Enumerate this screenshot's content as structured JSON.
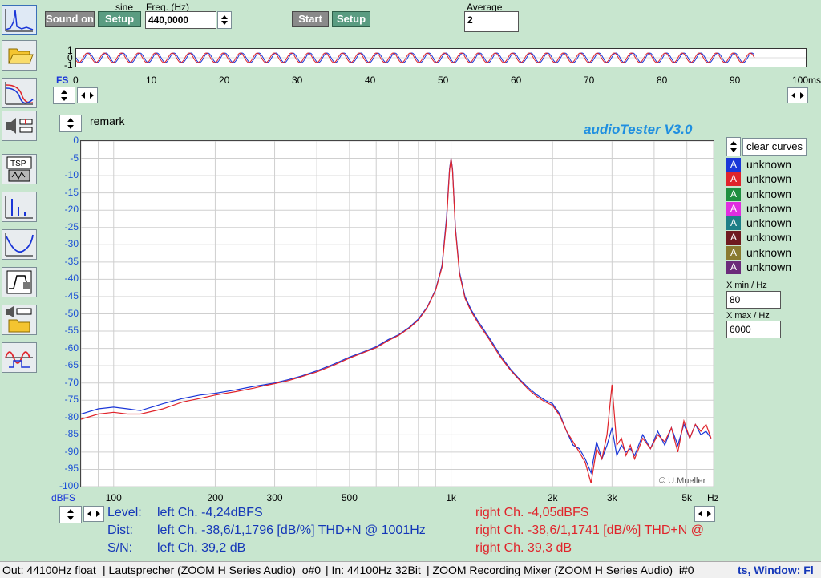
{
  "top": {
    "sound_button": "Sound on",
    "signal_type": "sine",
    "setup_left": "Setup",
    "freq_label": "Freq. (Hz)",
    "freq_value": "440,0000",
    "start_button": "Start",
    "setup_right": "Setup",
    "average_label": "Average",
    "average_value": "2"
  },
  "scope": {
    "y_ticks": [
      "1",
      "0",
      "-1"
    ],
    "fs_label": "FS",
    "x_ticks": [
      "0",
      "10",
      "20",
      "30",
      "40",
      "50",
      "60",
      "70",
      "80",
      "90"
    ],
    "x_unit": "100ms"
  },
  "remark": "remark",
  "app_title": "audioTester  V3.0",
  "copyright": "© U.Mueller",
  "legend": {
    "clear_button": "clear curves",
    "items": [
      {
        "label": "unknown",
        "letter": "A",
        "color": "#1a36d8"
      },
      {
        "label": "unknown",
        "letter": "A",
        "color": "#e0242b"
      },
      {
        "label": "unknown",
        "letter": "A",
        "color": "#1f8f3f"
      },
      {
        "label": "unknown",
        "letter": "A",
        "color": "#e02ee0"
      },
      {
        "label": "unknown",
        "letter": "A",
        "color": "#1d7f86"
      },
      {
        "label": "unknown",
        "letter": "A",
        "color": "#6f1a1f"
      },
      {
        "label": "unknown",
        "letter": "A",
        "color": "#8a7a30"
      },
      {
        "label": "unknown",
        "letter": "A",
        "color": "#6b2a7a"
      }
    ],
    "xmin_label": "X min / Hz",
    "xmin_value": "80",
    "xmax_label": "X max / Hz",
    "xmax_value": "6000"
  },
  "readouts": {
    "level_label": "Level:",
    "level_left": "left Ch. -4,24dBFS",
    "level_right": "right Ch. -4,05dBFS",
    "dist_label": "Dist:",
    "dist_left": "left Ch. -38,6/1,1796 [dB/%] THD+N  @ 1001Hz",
    "dist_right": "right Ch. -38,6/1,1741 [dB/%] THD+N  @",
    "sn_label": "S/N:",
    "sn_left": "left Ch. 39,2 dB",
    "sn_right": "right Ch. 39,3 dB"
  },
  "status": {
    "out": "Out: 44100Hz float",
    "out_device": "| Lautsprecher (ZOOM H Series Audio)_o#0",
    "in": "| In: 44100Hz 32Bit",
    "in_device": "| ZOOM Recording Mixer (ZOOM H Series Audio)_i#0",
    "tail": "ts, Window: Fl"
  },
  "chart_data": {
    "type": "line",
    "title": "",
    "xlabel": "Hz",
    "ylabel": "dBFS",
    "x_scale": "log",
    "xlim": [
      80,
      6000
    ],
    "ylim": [
      -100,
      0
    ],
    "x_ticks": [
      "100",
      "200",
      "300",
      "500",
      "1k",
      "2k",
      "3k",
      "5k"
    ],
    "x_tick_values": [
      100,
      200,
      300,
      500,
      1000,
      2000,
      3000,
      5000
    ],
    "y_ticks": [
      "0",
      "-5",
      "-10",
      "-15",
      "-20",
      "-25",
      "-30",
      "-35",
      "-40",
      "-45",
      "-50",
      "-55",
      "-60",
      "-65",
      "-70",
      "-75",
      "-80",
      "-85",
      "-90",
      "-95",
      "-100"
    ],
    "grid": true,
    "series": [
      {
        "color": "#1a36d8",
        "x": [
          80,
          90,
          100,
          110,
          120,
          140,
          160,
          180,
          200,
          230,
          260,
          280,
          300,
          330,
          360,
          400,
          450,
          500,
          550,
          600,
          650,
          700,
          750,
          800,
          850,
          900,
          940,
          970,
          990,
          1000,
          1010,
          1030,
          1060,
          1100,
          1150,
          1200,
          1300,
          1400,
          1500,
          1600,
          1700,
          1800,
          1900,
          2000,
          2100,
          2200,
          2300,
          2400,
          2500,
          2600,
          2700,
          2800,
          2900,
          3000,
          3100,
          3200,
          3300,
          3400,
          3500,
          3700,
          3900,
          4100,
          4300,
          4500,
          4700,
          4900,
          5100,
          5300,
          5500,
          5700,
          5900
        ],
        "y": [
          -79,
          -77.5,
          -77,
          -77.5,
          -78,
          -76,
          -74.5,
          -73.5,
          -73,
          -72,
          -71,
          -70.5,
          -70,
          -69,
          -68,
          -66.5,
          -64.5,
          -62.5,
          -61,
          -59.5,
          -57.5,
          -56,
          -54,
          -51.5,
          -48,
          -43,
          -36,
          -22,
          -8,
          -5,
          -8,
          -25,
          -38,
          -45,
          -49,
          -52,
          -57,
          -62,
          -66,
          -69,
          -71.5,
          -73.5,
          -75,
          -76,
          -79,
          -84,
          -88,
          -89,
          -92,
          -96,
          -87,
          -92,
          -88,
          -83,
          -91,
          -88,
          -90,
          -89,
          -91,
          -85,
          -89,
          -84,
          -88,
          -83,
          -88,
          -82,
          -86,
          -82,
          -85,
          -84,
          -86
        ]
      },
      {
        "color": "#e0242b",
        "x": [
          80,
          90,
          100,
          110,
          120,
          140,
          160,
          180,
          200,
          230,
          260,
          280,
          300,
          330,
          360,
          400,
          450,
          500,
          550,
          600,
          650,
          700,
          750,
          800,
          850,
          900,
          940,
          970,
          990,
          1000,
          1010,
          1030,
          1060,
          1100,
          1150,
          1200,
          1300,
          1400,
          1500,
          1600,
          1700,
          1800,
          1900,
          2000,
          2100,
          2200,
          2300,
          2400,
          2500,
          2600,
          2700,
          2800,
          2900,
          3000,
          3100,
          3200,
          3300,
          3400,
          3500,
          3700,
          3900,
          4100,
          4300,
          4500,
          4700,
          4900,
          5100,
          5300,
          5500,
          5700,
          5900
        ],
        "y": [
          -80.5,
          -79,
          -78.5,
          -79,
          -79,
          -77.5,
          -75.5,
          -74.5,
          -73.5,
          -72.5,
          -71.5,
          -70.8,
          -70.2,
          -69.3,
          -68.2,
          -66.8,
          -64.8,
          -62.8,
          -61.2,
          -59.8,
          -57.8,
          -56.2,
          -54.2,
          -51.8,
          -48.2,
          -43.2,
          -36.5,
          -23,
          -8.5,
          -5,
          -8.5,
          -25.5,
          -38.5,
          -45.5,
          -49.5,
          -52.5,
          -57.5,
          -62.5,
          -66.3,
          -69.3,
          -72,
          -74,
          -75.5,
          -76.5,
          -79.5,
          -84,
          -87,
          -90,
          -93,
          -99,
          -89,
          -92,
          -85,
          -70.5,
          -88,
          -86,
          -91,
          -88,
          -92,
          -86,
          -89,
          -85,
          -87,
          -83,
          -90,
          -81,
          -86,
          -82,
          -84,
          -82,
          -86
        ]
      }
    ]
  }
}
